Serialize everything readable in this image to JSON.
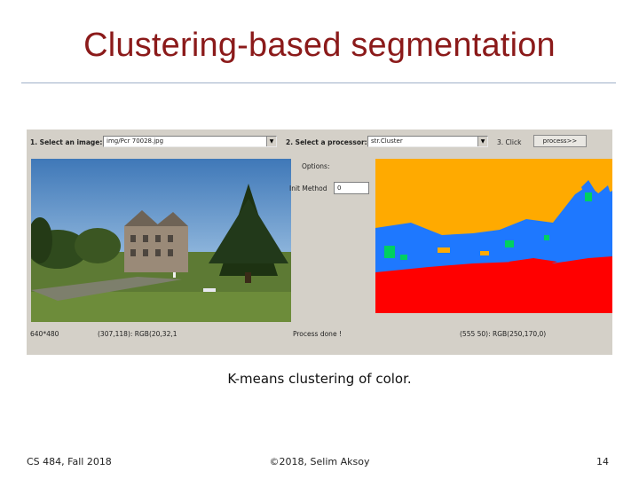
{
  "slide": {
    "title": "Clustering-based segmentation",
    "caption": "K-means clustering of color."
  },
  "app": {
    "select_image_label": "1. Select an image:",
    "image_value": "img/Pcr 70028.jpg",
    "select_processor_label": "2. Select a processor:",
    "processor_value": "str.Cluster",
    "click_label": "3. Click",
    "process_button": "process>>",
    "options_label": "Options:",
    "init_method_label": "Init Method",
    "init_method_value": "0",
    "image_size": "640*480",
    "pixel_info_left": "(307,118): RGB(20,32,1",
    "status": "Process done !",
    "pixel_info_right": "(555 50): RGB(250,170,0)"
  },
  "colors": {
    "title": "#8b1a1a",
    "segment_orange": "#ffaa00",
    "segment_red": "#ff0000",
    "segment_blue": "#1e78ff",
    "segment_green": "#00d060",
    "panel_gray": "#d4d0c8"
  },
  "footer": {
    "course": "CS 484, Fall 2018",
    "copyright": "©2018, Selim Aksoy",
    "page": "14"
  }
}
